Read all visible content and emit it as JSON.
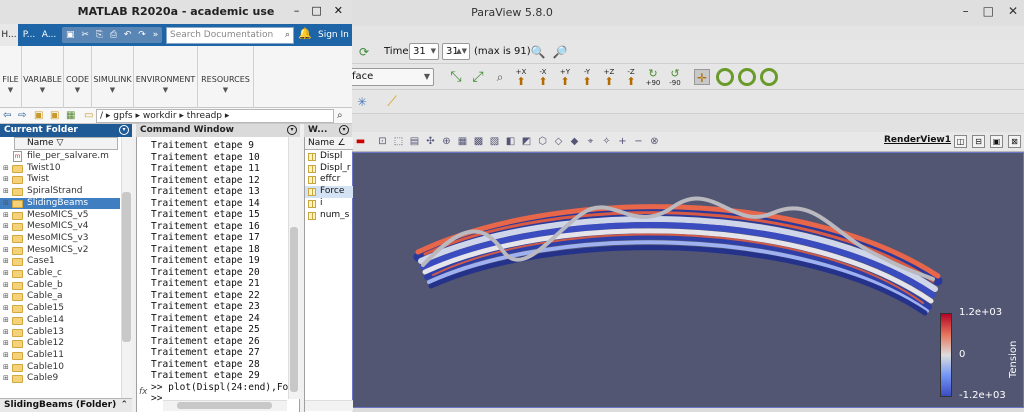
{
  "paraview": {
    "window_title": "ParaView 5.8.0",
    "win_buttons": [
      "–",
      "□",
      "✕"
    ],
    "time_label": "Time:",
    "time_value": "31",
    "time_step": "31",
    "time_max": "(max is 91)",
    "representation": "face",
    "axis_buttons": [
      "+X",
      "-X",
      "+Y",
      "-Y",
      "+Z",
      "-Z"
    ],
    "rotate_buttons": [
      "+90",
      "-90"
    ],
    "render_view_label": "RenderView1",
    "legend": {
      "max": "1.2e+03",
      "mid": "0",
      "min": "-1.2e+03",
      "title": "Tension"
    },
    "background_color": "#525672"
  },
  "matlab": {
    "window_title": "MATLAB R2020a - academic use",
    "win_buttons": [
      "–",
      "□",
      "✕"
    ],
    "ribbon_tabs": [
      "H...",
      "P...",
      "A..."
    ],
    "search_placeholder": "Search Documentation",
    "sign_in": "Sign In",
    "ribbon_sections": [
      "FILE",
      "VARIABLE",
      "CODE",
      "SIMULINK",
      "ENVIRONMENT",
      "RESOURCES"
    ],
    "path_segments": [
      "/",
      "gpfs",
      "workdir",
      "threadp"
    ],
    "current_folder": {
      "title": "Current Folder",
      "column_name": "Name",
      "sort_indicator": "▽",
      "items": [
        {
          "name": "file_per_salvare.m",
          "type": "file",
          "selected": false
        },
        {
          "name": "Twist10",
          "type": "folder",
          "selected": false
        },
        {
          "name": "Twist",
          "type": "folder",
          "selected": false
        },
        {
          "name": "SpiralStrand",
          "type": "folder",
          "selected": false
        },
        {
          "name": "SlidingBeams",
          "type": "folder",
          "selected": true
        },
        {
          "name": "MesoMICS_v5",
          "type": "folder",
          "selected": false
        },
        {
          "name": "MesoMICS_v4",
          "type": "folder",
          "selected": false
        },
        {
          "name": "MesoMICS_v3",
          "type": "folder",
          "selected": false
        },
        {
          "name": "MesoMICS_v2",
          "type": "folder",
          "selected": false
        },
        {
          "name": "Case1",
          "type": "folder",
          "selected": false
        },
        {
          "name": "Cable_c",
          "type": "folder",
          "selected": false
        },
        {
          "name": "Cable_b",
          "type": "folder",
          "selected": false
        },
        {
          "name": "Cable_a",
          "type": "folder",
          "selected": false
        },
        {
          "name": "Cable15",
          "type": "folder",
          "selected": false
        },
        {
          "name": "Cable14",
          "type": "folder",
          "selected": false
        },
        {
          "name": "Cable13",
          "type": "folder",
          "selected": false
        },
        {
          "name": "Cable12",
          "type": "folder",
          "selected": false
        },
        {
          "name": "Cable11",
          "type": "folder",
          "selected": false
        },
        {
          "name": "Cable10",
          "type": "folder",
          "selected": false
        },
        {
          "name": "Cable9",
          "type": "folder",
          "selected": false
        }
      ],
      "status": "SlidingBeams  (Folder)"
    },
    "command_window": {
      "title": "Command Window",
      "lines": [
        "Traitement etape 9",
        "Traitement etape 10",
        "Traitement etape 11",
        "Traitement etape 12",
        "Traitement etape 13",
        "Traitement etape 14",
        "Traitement etape 15",
        "Traitement etape 16",
        "Traitement etape 17",
        "Traitement etape 18",
        "Traitement etape 19",
        "Traitement etape 20",
        "Traitement etape 21",
        "Traitement etape 22",
        "Traitement etape 23",
        "Traitement etape 24",
        "Traitement etape 25",
        "Traitement etape 26",
        "Traitement etape 27",
        "Traitement etape 28",
        "Traitement etape 29",
        ">> plot(Displ(24:end),Forc",
        ">>"
      ],
      "fx": "fx"
    },
    "workspace": {
      "title": "W...",
      "column_name": "Name",
      "sort_indicator": "∠",
      "items": [
        {
          "name": "Displ",
          "selected": false
        },
        {
          "name": "Displ_r",
          "selected": false
        },
        {
          "name": "effcr",
          "selected": false
        },
        {
          "name": "Force",
          "selected": true
        },
        {
          "name": "i",
          "selected": false
        },
        {
          "name": "num_s",
          "selected": false
        }
      ]
    }
  }
}
